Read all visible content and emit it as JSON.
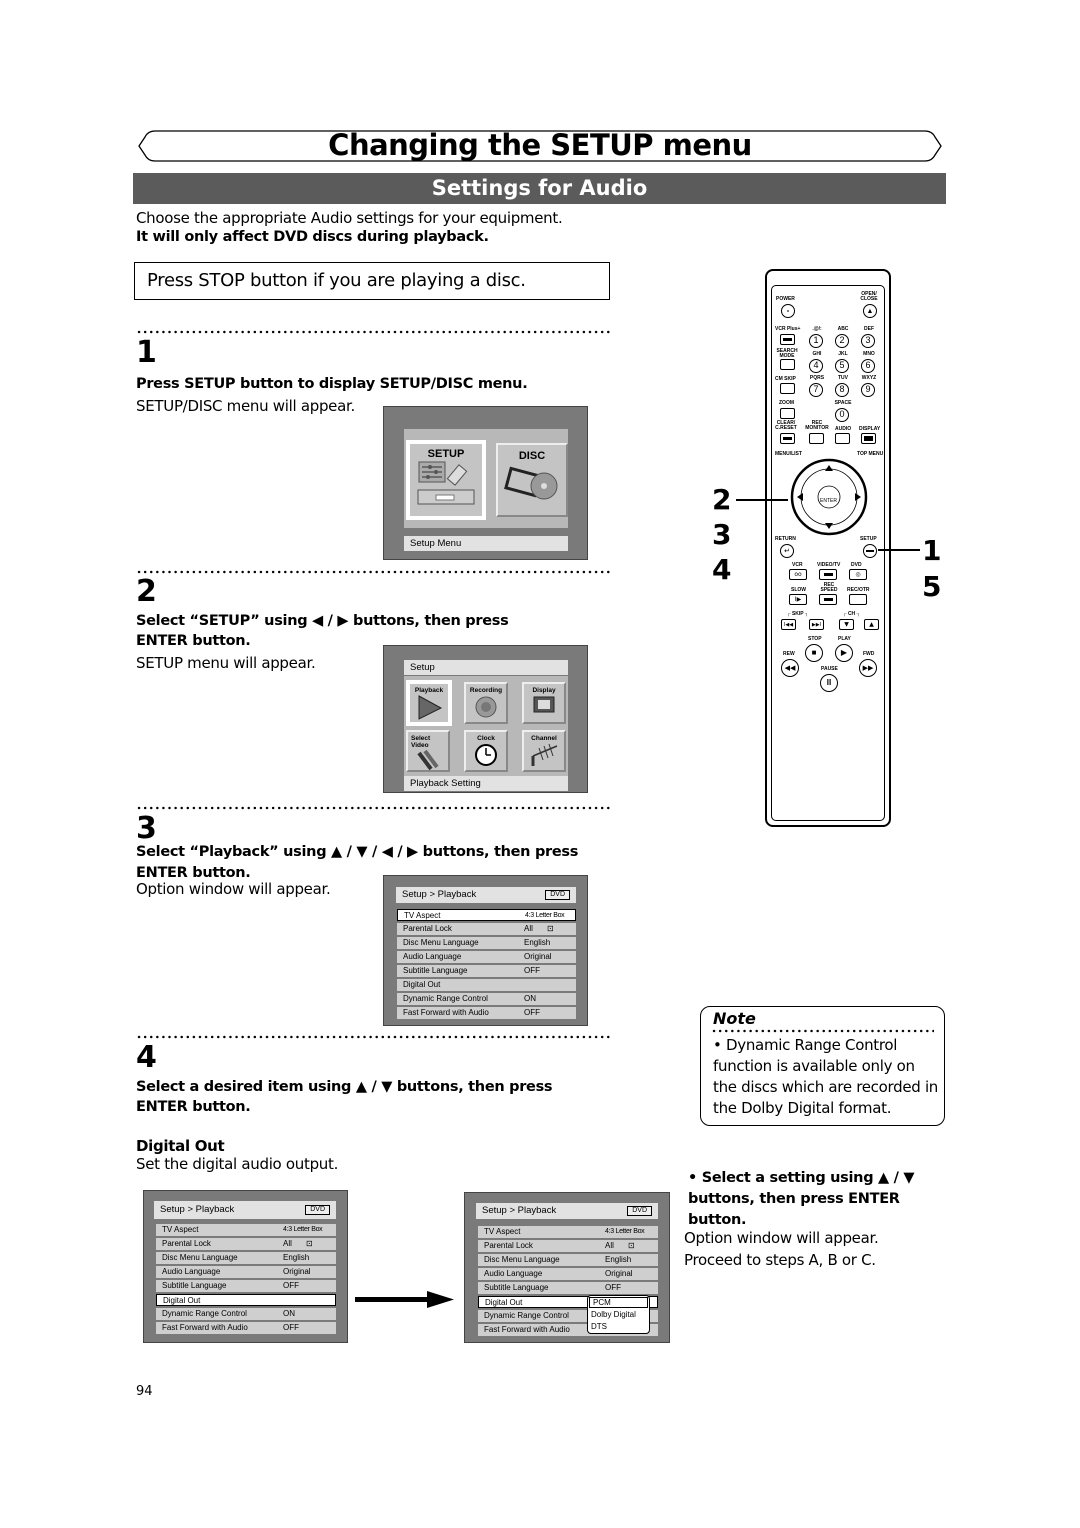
{
  "header": {
    "title": "Changing the SETUP menu",
    "section": "Settings for Audio"
  },
  "intro": {
    "line1": "Choose the appropriate Audio settings for your equipment.",
    "line2": "It will only affect DVD discs during playback."
  },
  "stop_notice": "Press STOP button if you are playing a disc.",
  "steps": [
    {
      "number": "1",
      "instruction": "Press SETUP button to display SETUP/DISC menu.",
      "description": "SETUP/DISC menu will appear."
    },
    {
      "number": "2",
      "instruction_line1": "Select “SETUP” using ◀ / ▶ buttons, then press",
      "instruction_line2": "ENTER button.",
      "description": "SETUP menu will appear."
    },
    {
      "number": "3",
      "instruction_line1": "Select “Playback” using ▲ / ▼ / ◀ / ▶ buttons, then press",
      "instruction_line2": "ENTER button.",
      "description": "Option window will appear."
    },
    {
      "number": "4",
      "instruction_line1": "Select a desired item using ▲ / ▼ buttons, then press",
      "instruction_line2": "ENTER button.",
      "subheading": "Digital Out",
      "description": "Set the digital audio output."
    }
  ],
  "screens": {
    "setup_disc": {
      "tiles": [
        {
          "label": "SETUP",
          "icon": "setup-icon",
          "selected": true
        },
        {
          "label": "DISC",
          "icon": "disc-icon",
          "selected": false
        }
      ],
      "status": "Setup Menu"
    },
    "setup": {
      "header": "Setup",
      "tiles": [
        {
          "label": "Playback",
          "icon": "play-icon",
          "selected": true
        },
        {
          "label": "Recording",
          "icon": "record-icon",
          "selected": false
        },
        {
          "label": "Display",
          "icon": "display-icon",
          "selected": false
        },
        {
          "label": "Select Video",
          "icon": "cable-icon",
          "selected": false
        },
        {
          "label": "Clock",
          "icon": "clock-icon",
          "selected": false
        },
        {
          "label": "Channel",
          "icon": "antenna-icon",
          "selected": false
        }
      ],
      "status": "Playback Setting"
    },
    "playback": {
      "header": "Setup > Playback",
      "badge": "DVD",
      "rows": [
        {
          "label": "TV Aspect",
          "value": "4:3 Letter Box"
        },
        {
          "label": "Parental Lock",
          "value": "All"
        },
        {
          "label": "Disc Menu Language",
          "value": "English"
        },
        {
          "label": "Audio Language",
          "value": "Original"
        },
        {
          "label": "Subtitle Language",
          "value": "OFF"
        },
        {
          "label": "Digital Out",
          "value": ""
        },
        {
          "label": "Dynamic Range Control",
          "value": "ON"
        },
        {
          "label": "Fast Forward with Audio",
          "value": "OFF"
        }
      ],
      "popup_options": [
        "PCM",
        "Dolby Digital",
        "DTS"
      ],
      "popup_selected": "PCM"
    }
  },
  "remote": {
    "labels": {
      "power": "POWER",
      "open_close": "OPEN/ CLOSE",
      "vcr_plus": "VCR Plus+",
      "search_mode": "SEARCH MODE",
      "cm_skip": "CM SKIP",
      "zoom": "ZOOM",
      "clear": "CLEAR/ C.RESET",
      "rec_monitor": "REC MONITOR",
      "audio": "AUDIO",
      "display": "DISPLAY",
      "menu_list": "MENU/LIST",
      "top_menu": "TOP MENU",
      "enter": "ENTER",
      "return": "RETURN",
      "setup": "SETUP",
      "vcr": "VCR",
      "video_tv": "VIDEO/TV",
      "dvd": "DVD",
      "slow": "SLOW",
      "rec_speed": "REC SPEED",
      "rec_otr": "REC/OTR",
      "skip": "SKIP",
      "ch": "CH",
      "stop": "STOP",
      "play": "PLAY",
      "rew": "REW",
      "fwd": "FWD",
      "pause": "PAUSE",
      "space": "SPACE"
    },
    "keypad": [
      {
        "num": "1",
        "letters": ".@/:"
      },
      {
        "num": "2",
        "letters": "ABC"
      },
      {
        "num": "3",
        "letters": "DEF"
      },
      {
        "num": "4",
        "letters": "GHI"
      },
      {
        "num": "5",
        "letters": "JKL"
      },
      {
        "num": "6",
        "letters": "MNO"
      },
      {
        "num": "7",
        "letters": "PQRS"
      },
      {
        "num": "8",
        "letters": "TUV"
      },
      {
        "num": "9",
        "letters": "WXYZ"
      },
      {
        "num": "0",
        "letters": "SPACE"
      }
    ],
    "callouts_left": [
      "2",
      "3",
      "4"
    ],
    "callouts_right": [
      "1",
      "5"
    ]
  },
  "note": {
    "title": "Note",
    "text": "• Dynamic Range Control function is available only on the discs which are recorded in the Dolby Digital format."
  },
  "setting_step": {
    "instruction": "• Select a setting using ▲ / ▼ buttons, then press ENTER button.",
    "line1": "Option window will appear.",
    "line2": "Proceed to steps A, B or C."
  },
  "page_number": "94"
}
